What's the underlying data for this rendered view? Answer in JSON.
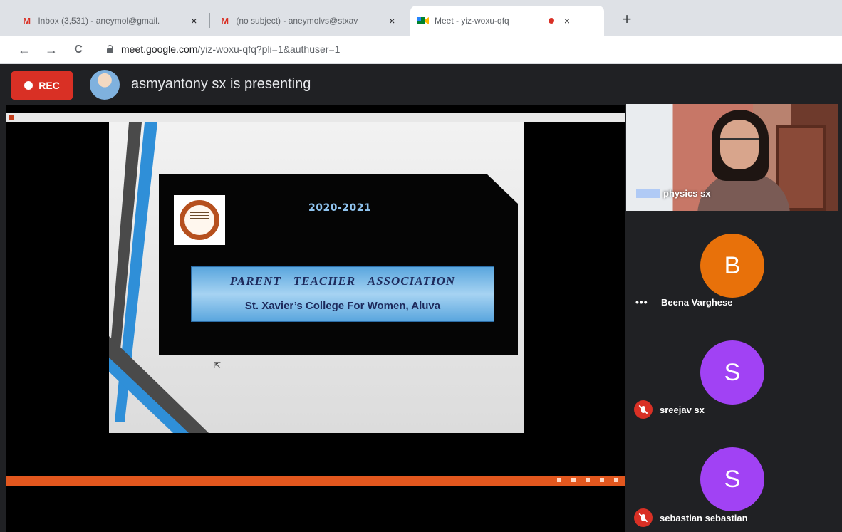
{
  "browser": {
    "tabs": [
      {
        "icon": "gmail-icon",
        "title": "Inbox (3,531) - aneymol@gmail.",
        "active": false
      },
      {
        "icon": "gmail-icon",
        "title": "(no subject) - aneymolvs@stxav",
        "active": false
      },
      {
        "icon": "meet-icon",
        "title": "Meet - yiz-woxu-qfq",
        "active": true
      }
    ],
    "new_tab_label": "+",
    "close_label": "×",
    "url_host": "meet.google.com",
    "url_path": "/yiz-woxu-qfq?pli=1&authuser=1",
    "nav": {
      "back": "←",
      "forward": "→",
      "reload": "C"
    }
  },
  "meet": {
    "rec_label": "REC",
    "presenting_text": "asmyantony sx is presenting",
    "colors": {
      "rec": "#d93025",
      "avatar_b": "#e8710a",
      "avatar_s": "#a142f4"
    }
  },
  "slide": {
    "year": "2020-2021",
    "pta_title": "PARENT TEACHER ASSOCIATION",
    "college": "St. Xavier’s College For Women, Aluva"
  },
  "participants": [
    {
      "name": "physics sx",
      "type": "video"
    },
    {
      "name": "Beena Varghese",
      "initial": "B",
      "status": "more-options"
    },
    {
      "name": "sreejav sx",
      "initial": "S",
      "status": "muted"
    },
    {
      "name": "sebastian sebastian",
      "initial": "S",
      "status": "muted"
    }
  ]
}
